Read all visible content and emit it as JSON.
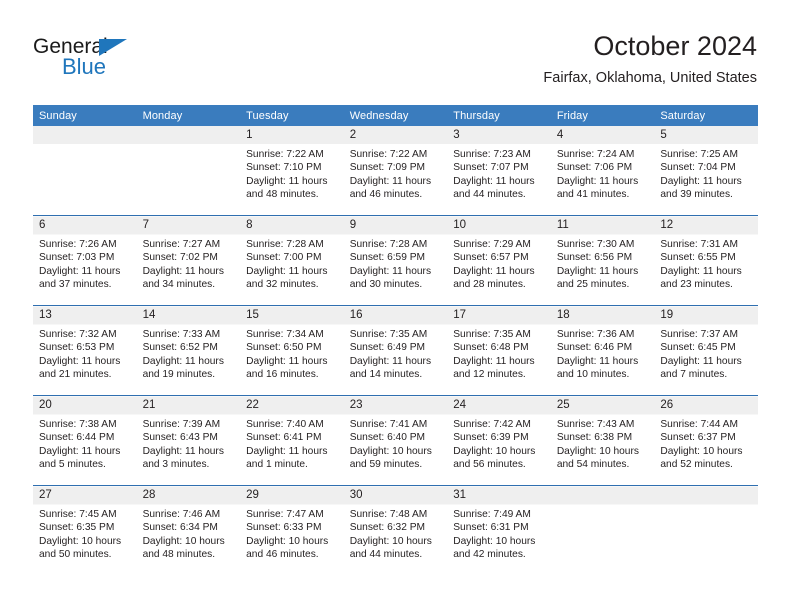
{
  "brand": {
    "name_top": "General",
    "name_bottom": "Blue",
    "accent_color": "#1f76bc"
  },
  "header": {
    "title": "October 2024",
    "subtitle": "Fairfax, Oklahoma, United States"
  },
  "theme": {
    "header_bg": "#3a7cbe",
    "row_divider": "#2f6fb0",
    "daynum_band": "#efefef",
    "text": "#231f20"
  },
  "weekday_headers": [
    "Sunday",
    "Monday",
    "Tuesday",
    "Wednesday",
    "Thursday",
    "Friday",
    "Saturday"
  ],
  "weeks": [
    [
      {
        "day": "",
        "lines": []
      },
      {
        "day": "",
        "lines": []
      },
      {
        "day": "1",
        "lines": [
          "Sunrise: 7:22 AM",
          "Sunset: 7:10 PM",
          "Daylight: 11 hours",
          "and 48 minutes."
        ]
      },
      {
        "day": "2",
        "lines": [
          "Sunrise: 7:22 AM",
          "Sunset: 7:09 PM",
          "Daylight: 11 hours",
          "and 46 minutes."
        ]
      },
      {
        "day": "3",
        "lines": [
          "Sunrise: 7:23 AM",
          "Sunset: 7:07 PM",
          "Daylight: 11 hours",
          "and 44 minutes."
        ]
      },
      {
        "day": "4",
        "lines": [
          "Sunrise: 7:24 AM",
          "Sunset: 7:06 PM",
          "Daylight: 11 hours",
          "and 41 minutes."
        ]
      },
      {
        "day": "5",
        "lines": [
          "Sunrise: 7:25 AM",
          "Sunset: 7:04 PM",
          "Daylight: 11 hours",
          "and 39 minutes."
        ]
      }
    ],
    [
      {
        "day": "6",
        "lines": [
          "Sunrise: 7:26 AM",
          "Sunset: 7:03 PM",
          "Daylight: 11 hours",
          "and 37 minutes."
        ]
      },
      {
        "day": "7",
        "lines": [
          "Sunrise: 7:27 AM",
          "Sunset: 7:02 PM",
          "Daylight: 11 hours",
          "and 34 minutes."
        ]
      },
      {
        "day": "8",
        "lines": [
          "Sunrise: 7:28 AM",
          "Sunset: 7:00 PM",
          "Daylight: 11 hours",
          "and 32 minutes."
        ]
      },
      {
        "day": "9",
        "lines": [
          "Sunrise: 7:28 AM",
          "Sunset: 6:59 PM",
          "Daylight: 11 hours",
          "and 30 minutes."
        ]
      },
      {
        "day": "10",
        "lines": [
          "Sunrise: 7:29 AM",
          "Sunset: 6:57 PM",
          "Daylight: 11 hours",
          "and 28 minutes."
        ]
      },
      {
        "day": "11",
        "lines": [
          "Sunrise: 7:30 AM",
          "Sunset: 6:56 PM",
          "Daylight: 11 hours",
          "and 25 minutes."
        ]
      },
      {
        "day": "12",
        "lines": [
          "Sunrise: 7:31 AM",
          "Sunset: 6:55 PM",
          "Daylight: 11 hours",
          "and 23 minutes."
        ]
      }
    ],
    [
      {
        "day": "13",
        "lines": [
          "Sunrise: 7:32 AM",
          "Sunset: 6:53 PM",
          "Daylight: 11 hours",
          "and 21 minutes."
        ]
      },
      {
        "day": "14",
        "lines": [
          "Sunrise: 7:33 AM",
          "Sunset: 6:52 PM",
          "Daylight: 11 hours",
          "and 19 minutes."
        ]
      },
      {
        "day": "15",
        "lines": [
          "Sunrise: 7:34 AM",
          "Sunset: 6:50 PM",
          "Daylight: 11 hours",
          "and 16 minutes."
        ]
      },
      {
        "day": "16",
        "lines": [
          "Sunrise: 7:35 AM",
          "Sunset: 6:49 PM",
          "Daylight: 11 hours",
          "and 14 minutes."
        ]
      },
      {
        "day": "17",
        "lines": [
          "Sunrise: 7:35 AM",
          "Sunset: 6:48 PM",
          "Daylight: 11 hours",
          "and 12 minutes."
        ]
      },
      {
        "day": "18",
        "lines": [
          "Sunrise: 7:36 AM",
          "Sunset: 6:46 PM",
          "Daylight: 11 hours",
          "and 10 minutes."
        ]
      },
      {
        "day": "19",
        "lines": [
          "Sunrise: 7:37 AM",
          "Sunset: 6:45 PM",
          "Daylight: 11 hours",
          "and 7 minutes."
        ]
      }
    ],
    [
      {
        "day": "20",
        "lines": [
          "Sunrise: 7:38 AM",
          "Sunset: 6:44 PM",
          "Daylight: 11 hours",
          "and 5 minutes."
        ]
      },
      {
        "day": "21",
        "lines": [
          "Sunrise: 7:39 AM",
          "Sunset: 6:43 PM",
          "Daylight: 11 hours",
          "and 3 minutes."
        ]
      },
      {
        "day": "22",
        "lines": [
          "Sunrise: 7:40 AM",
          "Sunset: 6:41 PM",
          "Daylight: 11 hours",
          "and 1 minute."
        ]
      },
      {
        "day": "23",
        "lines": [
          "Sunrise: 7:41 AM",
          "Sunset: 6:40 PM",
          "Daylight: 10 hours",
          "and 59 minutes."
        ]
      },
      {
        "day": "24",
        "lines": [
          "Sunrise: 7:42 AM",
          "Sunset: 6:39 PM",
          "Daylight: 10 hours",
          "and 56 minutes."
        ]
      },
      {
        "day": "25",
        "lines": [
          "Sunrise: 7:43 AM",
          "Sunset: 6:38 PM",
          "Daylight: 10 hours",
          "and 54 minutes."
        ]
      },
      {
        "day": "26",
        "lines": [
          "Sunrise: 7:44 AM",
          "Sunset: 6:37 PM",
          "Daylight: 10 hours",
          "and 52 minutes."
        ]
      }
    ],
    [
      {
        "day": "27",
        "lines": [
          "Sunrise: 7:45 AM",
          "Sunset: 6:35 PM",
          "Daylight: 10 hours",
          "and 50 minutes."
        ]
      },
      {
        "day": "28",
        "lines": [
          "Sunrise: 7:46 AM",
          "Sunset: 6:34 PM",
          "Daylight: 10 hours",
          "and 48 minutes."
        ]
      },
      {
        "day": "29",
        "lines": [
          "Sunrise: 7:47 AM",
          "Sunset: 6:33 PM",
          "Daylight: 10 hours",
          "and 46 minutes."
        ]
      },
      {
        "day": "30",
        "lines": [
          "Sunrise: 7:48 AM",
          "Sunset: 6:32 PM",
          "Daylight: 10 hours",
          "and 44 minutes."
        ]
      },
      {
        "day": "31",
        "lines": [
          "Sunrise: 7:49 AM",
          "Sunset: 6:31 PM",
          "Daylight: 10 hours",
          "and 42 minutes."
        ]
      },
      {
        "day": "",
        "lines": []
      },
      {
        "day": "",
        "lines": []
      }
    ]
  ]
}
